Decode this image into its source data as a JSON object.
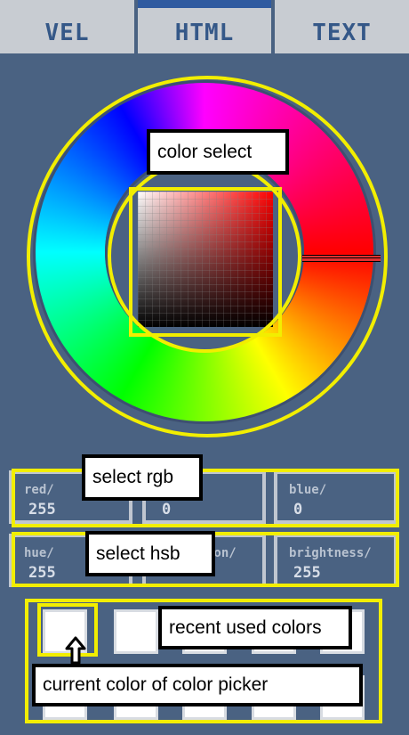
{
  "tabs": [
    {
      "label": "VEL",
      "active": false
    },
    {
      "label": "HTML",
      "active": true
    },
    {
      "label": "TEXT",
      "active": false
    }
  ],
  "colors": {
    "background": "#4a6282",
    "tab_bg": "#c8ccd2",
    "tab_text": "#355888",
    "highlight": "#f2ee00"
  },
  "annotations": {
    "color_select": "color select",
    "select_rgb": "select rgb",
    "select_hsb": "select hsb",
    "recent_colors": "recent used colors",
    "current_color": "current color of color picker"
  },
  "rgb_fields": [
    {
      "label": "red/",
      "value": "255"
    },
    {
      "label": "",
      "value": "0"
    },
    {
      "label": "blue/",
      "value": "0"
    }
  ],
  "hsb_fields": [
    {
      "label": "hue/",
      "value": "255"
    },
    {
      "label": "ion/",
      "value": ""
    },
    {
      "label": "brightness/",
      "value": "255"
    }
  ],
  "current_color": "#ffffff",
  "recent_colors": [
    "#ffffff",
    "#ffffff",
    "#ffffff",
    "#ffffff",
    "#ffffff",
    "#ffffff",
    "#ffffff",
    "#ffffff",
    "#ffffff",
    "#ffffff"
  ]
}
